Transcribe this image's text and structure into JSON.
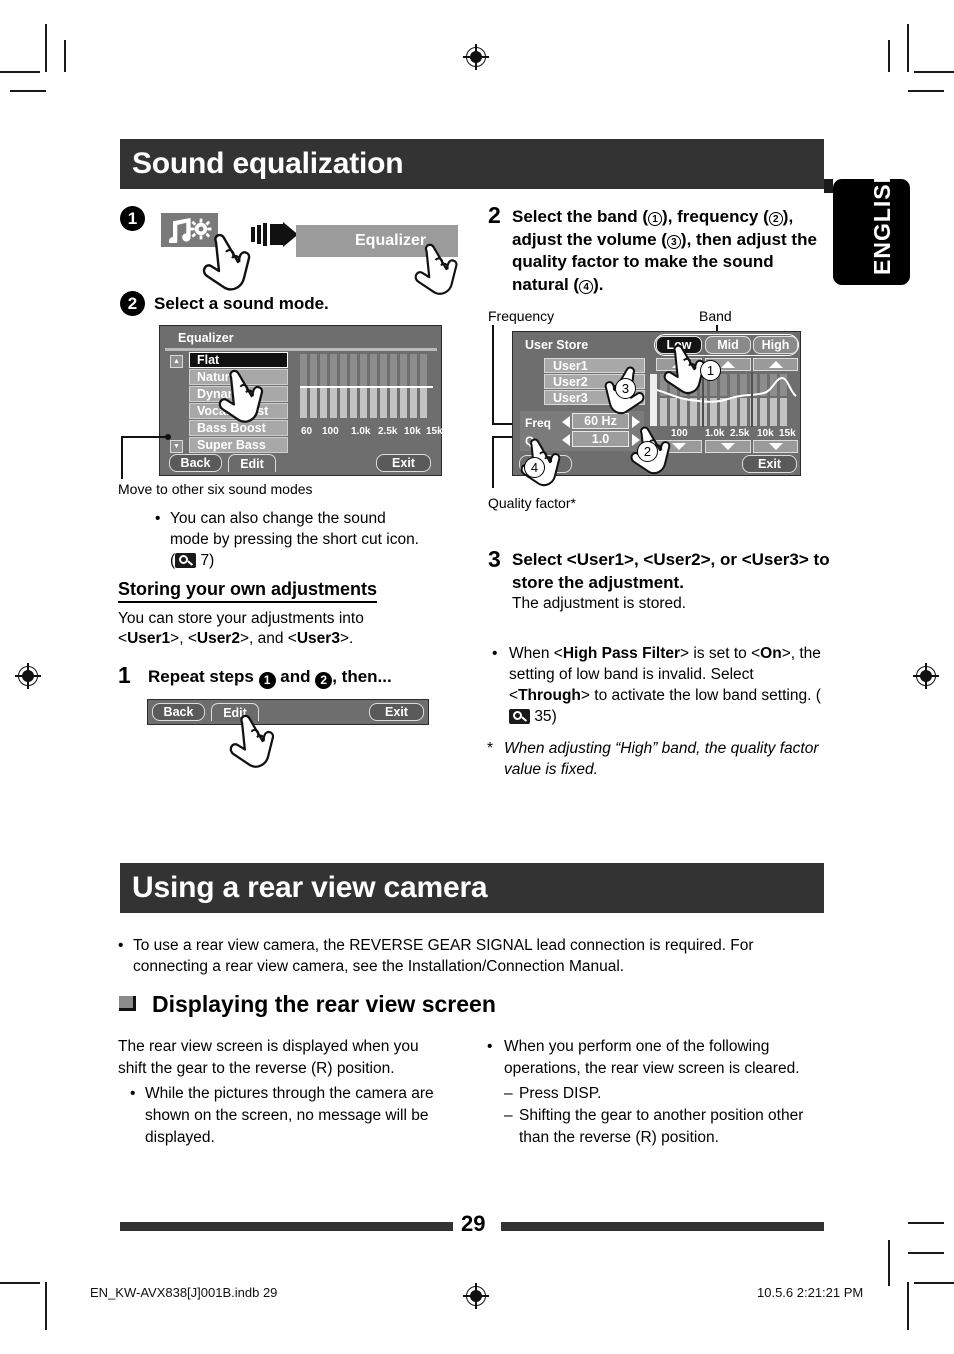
{
  "page": {
    "number": "29",
    "language_tab": "ENGLISH",
    "footer_file": "EN_KW-AVX838[J]001B.indb   29",
    "footer_timestamp": "10.5.6   2:21:21 PM"
  },
  "sections": [
    {
      "title": "Sound equalization"
    },
    {
      "title": "Using a rear view camera"
    }
  ],
  "sound_equalization": {
    "step1": {
      "num": "1",
      "source_icon": "music-settings-icon",
      "arrow_icon": "right-arrow-icon",
      "target_label": "Equalizer",
      "target_icon": "equalizer-icon"
    },
    "step2": {
      "num": "2",
      "text": "Select a sound mode."
    },
    "eq_screen": {
      "title": "Equalizer",
      "modes": [
        "Flat",
        "Natural",
        "Dynamic",
        "Vocal Boost",
        "Bass Boost",
        "Super Bass"
      ],
      "selected_mode": "Flat",
      "scroll_up_icon": "scroll-up-icon",
      "scroll_down_icon": "scroll-down-icon",
      "freq_labels": [
        "60",
        "100",
        "1.0k",
        "2.5k",
        "10k",
        "15k"
      ],
      "buttons": {
        "back": "Back",
        "edit": "Edit",
        "exit": "Exit"
      }
    },
    "callout_scroll": "Move to other six sound modes",
    "note_shortcut": {
      "text_before": "You can also change the sound mode by pressing the short cut icon. (",
      "icon": "magnifier-reference-icon",
      "page_ref": "7",
      "text_after": ")"
    },
    "storing_heading": "Storing your own adjustments",
    "storing_intro_1": "You can store your adjustments into <",
    "storing_user1": "User1",
    "storing_intro_2": ">, <",
    "storing_user2": "User2",
    "storing_intro_3": ">, and <",
    "storing_user3": "User3",
    "storing_intro_4": ">.",
    "repeat_step": {
      "num": "1",
      "text_a": "Repeat steps ",
      "bullet1": "1",
      "text_b": " and ",
      "bullet2": "2",
      "text_c": ", then..."
    },
    "edit_bar": {
      "back": "Back",
      "edit": "Edit",
      "exit": "Exit"
    }
  },
  "right_column": {
    "step2": {
      "num": "2",
      "line1_a": "Select the band (",
      "line1_n1": "1",
      "line1_b": "), frequency (",
      "line1_n2": "2",
      "line1_c": "),",
      "line2_a": "adjust the volume (",
      "line2_n3": "3",
      "line2_b": "), then adjust the",
      "line3": "quality factor to make the sound natural",
      "line4_a": "(",
      "line4_n4": "4",
      "line4_b": ")."
    },
    "callouts": {
      "frequency": "Frequency",
      "band": "Band",
      "quality_factor": "Quality factor*"
    },
    "user_screen": {
      "title": "User Store",
      "users": [
        "User1",
        "User2",
        "User3"
      ],
      "bands": [
        "Low",
        "Mid",
        "High"
      ],
      "selected_band": "Low",
      "freq_label": "Freq",
      "freq_value": "60 Hz",
      "q_label": "Q",
      "q_value": "1.0",
      "freq_labels": [
        "100",
        "1.0k",
        "2.5k",
        "10k",
        "15k"
      ],
      "exit": "Exit",
      "markers": [
        "1",
        "2",
        "3",
        "4"
      ]
    },
    "step3": {
      "num": "3",
      "line1_a": "Select <",
      "u1": "User1",
      "line1_b": ">, <",
      "u2": "User2",
      "line1_c": ">, or <",
      "u3": "User3",
      "line1_d": "> to",
      "line2": "store the adjustment.",
      "sub": "The adjustment is stored."
    },
    "note_hpf": {
      "a": "When <",
      "b": "High Pass Filter",
      "c": "> is set to <",
      "d": "On",
      "e": ">, the setting of low band is invalid. Select <",
      "f": "Through",
      "g": "> to activate the low band setting. (",
      "icon": "magnifier-reference-icon",
      "page_ref": "35",
      "h": ")"
    },
    "footnote": {
      "marker": "*",
      "text": "When adjusting “High” band, the quality factor value is fixed."
    }
  },
  "rear_view_camera": {
    "intro_bullet": "To use a rear view camera, the REVERSE GEAR SIGNAL lead connection is required. For connecting a rear view camera, see the Installation/Connection Manual.",
    "subheading": "Displaying the rear view screen",
    "left": {
      "para": "The rear view screen is displayed when you shift the gear to the reverse (R) position.",
      "bullet": "While the pictures through the camera are shown on the screen, no message will be displayed."
    },
    "right": {
      "bullet": "When you perform one of the following operations, the rear view screen is cleared.",
      "dash1": "Press DISP.",
      "dash2": "Shifting the gear to another position other than the reverse (R) position."
    }
  }
}
